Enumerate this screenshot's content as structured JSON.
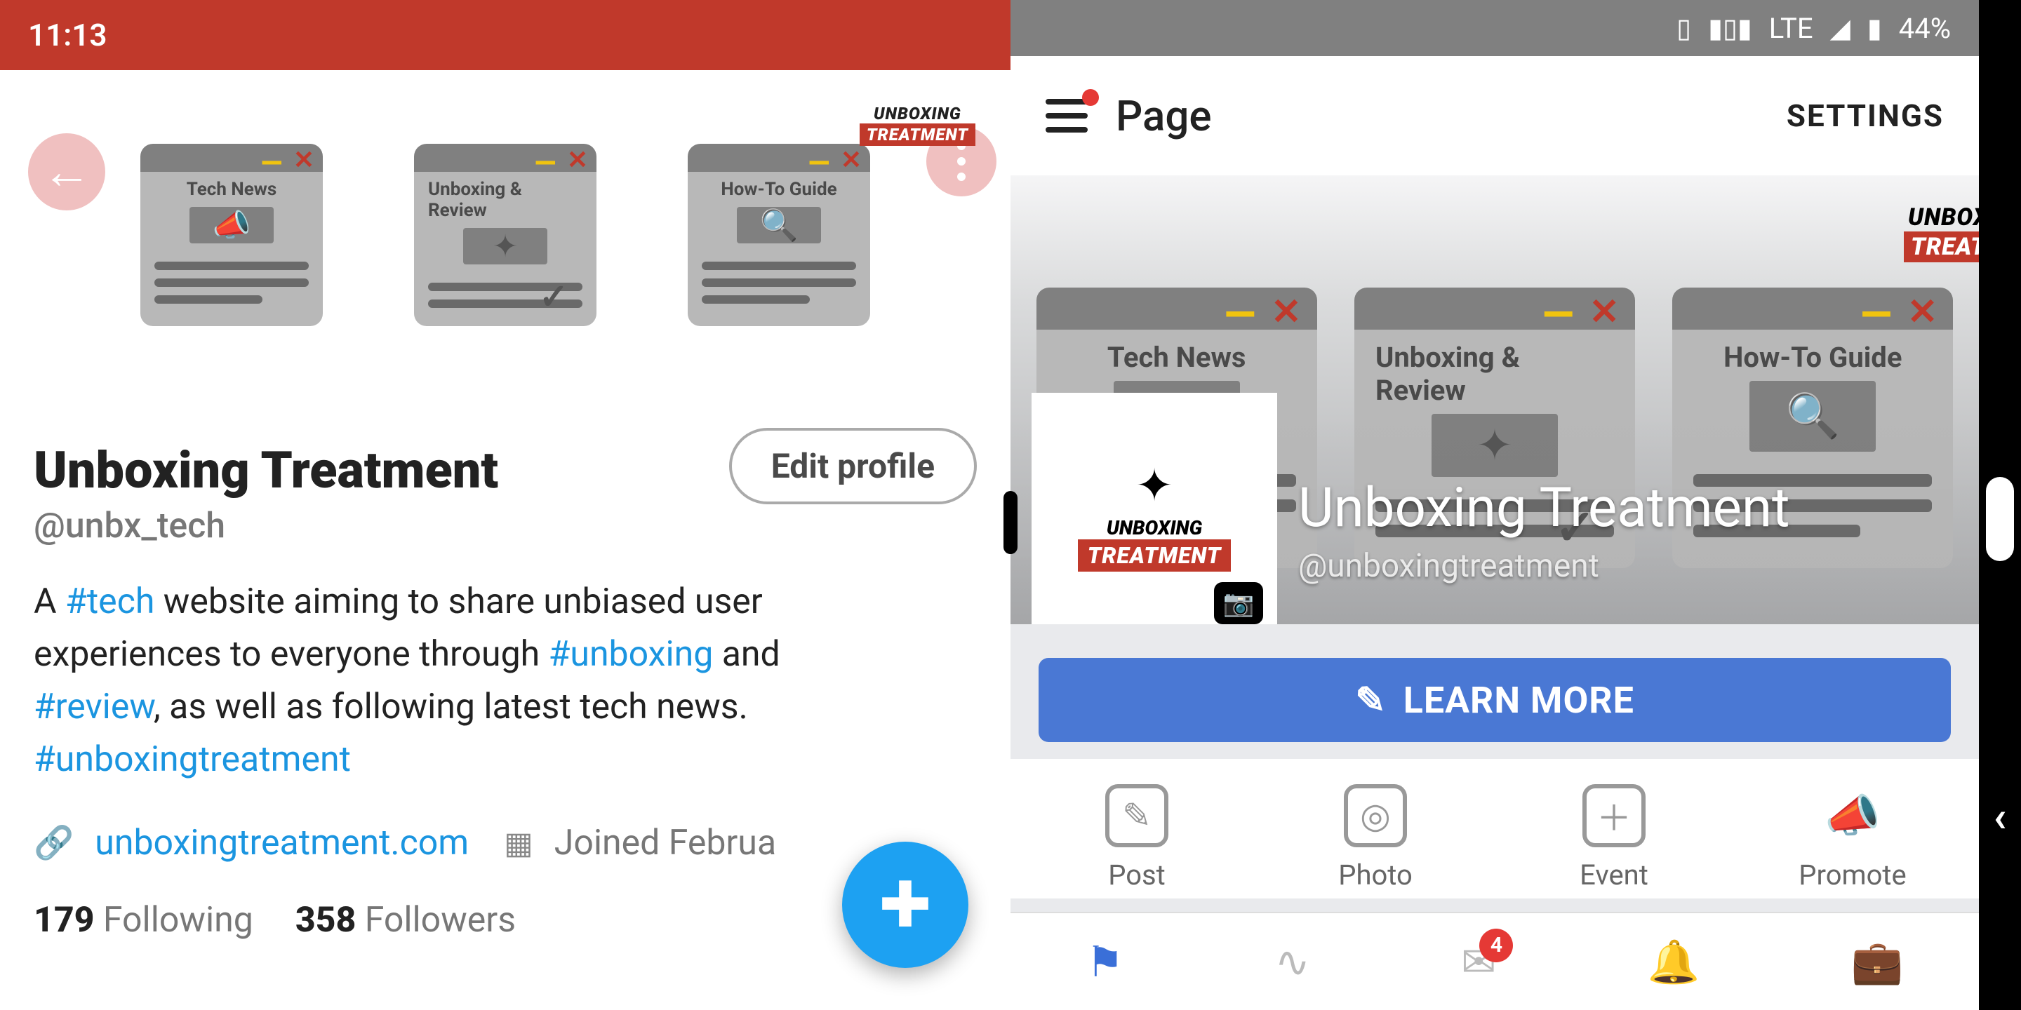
{
  "left_status": {
    "time": "11:13"
  },
  "twitter": {
    "header_cards": [
      {
        "title": "Tech News",
        "icon": "megaphone"
      },
      {
        "title": "Unboxing & Review",
        "icon": "patch",
        "check": true
      },
      {
        "title": "How-To Guide",
        "icon": "search"
      }
    ],
    "logo": {
      "top": "UNBOXING",
      "bottom": "TREATMENT"
    },
    "edit_label": "Edit profile",
    "name": "Unboxing Treatment",
    "handle": "@unbx_tech",
    "bio": {
      "t1": "A ",
      "h1": "#tech",
      "t2": " website aiming to share unbiased user experiences to everyone through ",
      "h2": "#unboxing",
      "t3": " and ",
      "h3": "#review",
      "t4": ", as well as following latest tech news. ",
      "h4": "#unboxingtreatment"
    },
    "link": "unboxingtreatment.com",
    "joined": "Joined Februa",
    "following_count": "179",
    "following_label": "Following",
    "followers_count": "358",
    "followers_label": "Followers"
  },
  "right_status": {
    "network": "LTE",
    "battery": "44%"
  },
  "facebook": {
    "page_label": "Page",
    "settings_label": "SETTINGS",
    "cover_cards": [
      {
        "title": "Tech News",
        "icon": "megaphone"
      },
      {
        "title": "Unboxing & Review",
        "icon": "patch",
        "check": true
      },
      {
        "title": "How-To Guide",
        "icon": "search"
      }
    ],
    "logo": {
      "top": "UNBOX",
      "bottom": "TREAT"
    },
    "avatar": {
      "top": "UNBOXING",
      "bottom": "TREATMENT"
    },
    "page_name": "Unboxing Treatment",
    "page_handle": "@unboxingtreatment",
    "learn_more": "LEARN MORE",
    "actions": [
      {
        "label": "Post",
        "icon": "edit"
      },
      {
        "label": "Photo",
        "icon": "camera"
      },
      {
        "label": "Event",
        "icon": "plus"
      },
      {
        "label": "Promote",
        "icon": "megaphone"
      }
    ],
    "nav_badge": "4"
  }
}
